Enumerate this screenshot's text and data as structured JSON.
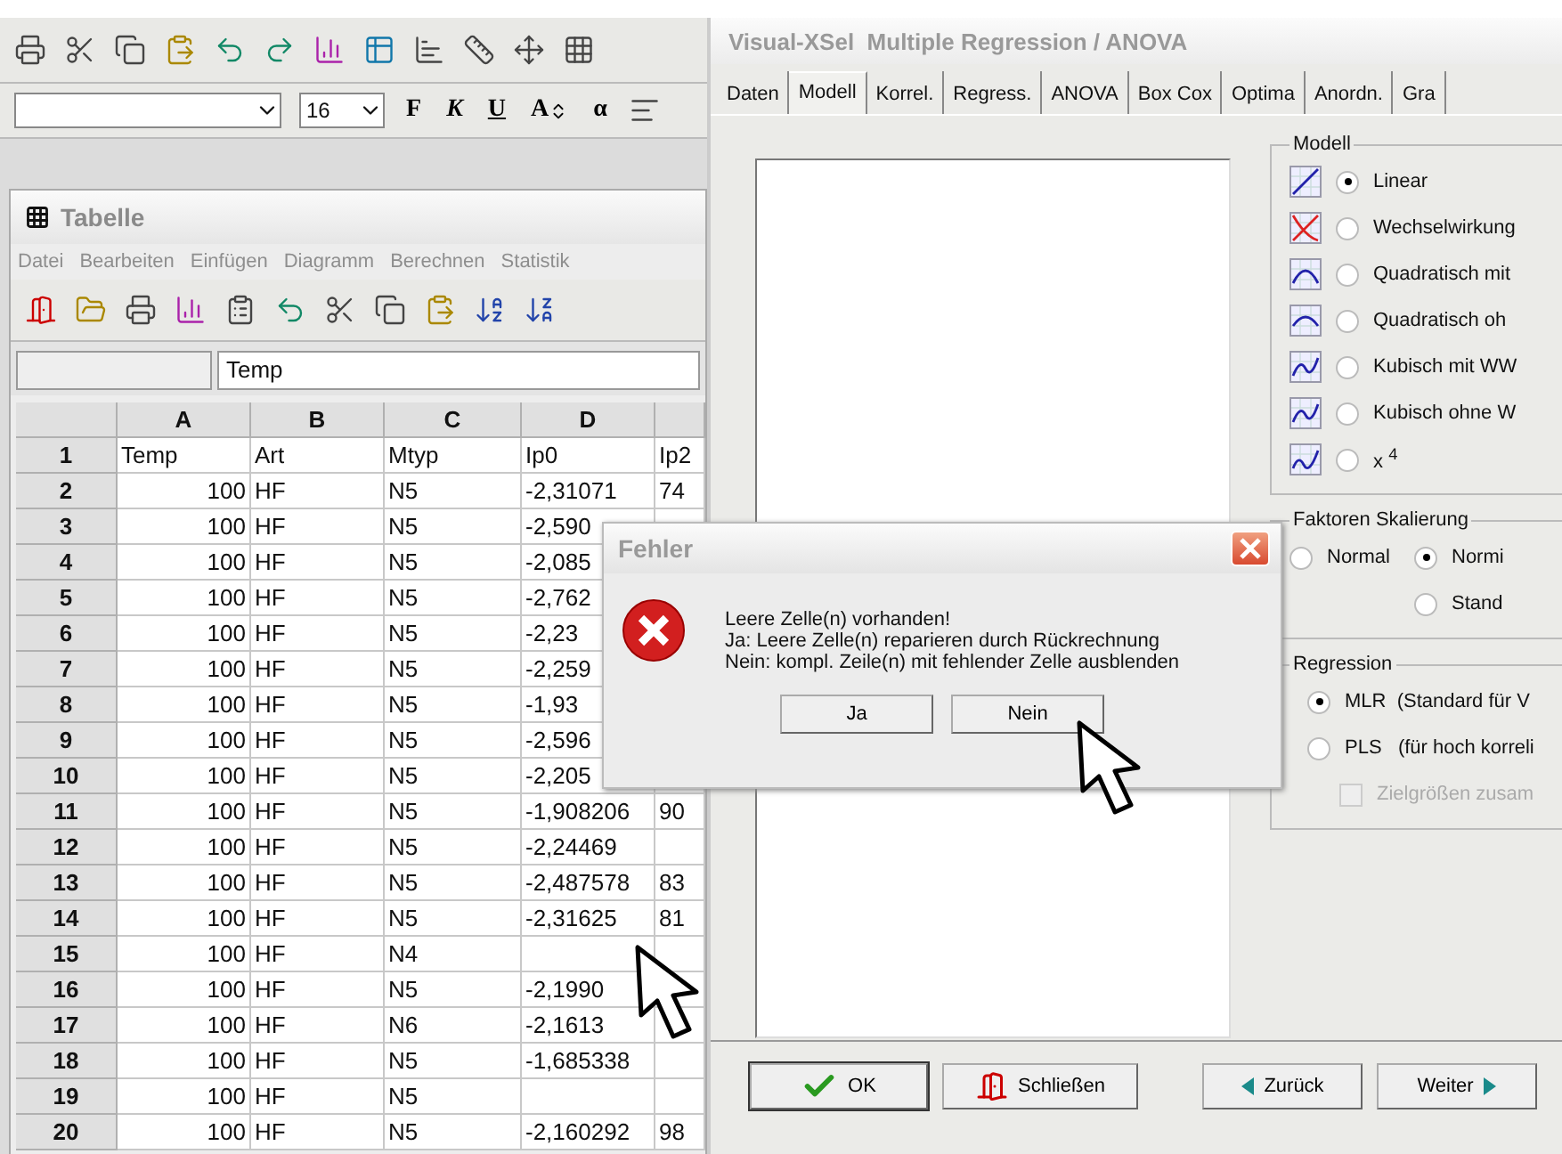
{
  "main_toolbar": {
    "font_size": {
      "value": "16"
    },
    "format_buttons": [
      "F",
      "K",
      "U",
      "A",
      "α"
    ]
  },
  "table_window": {
    "title": "Tabelle",
    "menu": [
      "Datei",
      "Bearbeiten",
      "Einfügen",
      "Diagramm",
      "Berechnen",
      "Statistik"
    ],
    "formula": "Temp",
    "columns": [
      "A",
      "B",
      "C",
      "D"
    ],
    "rows": [
      {
        "n": "1",
        "A": "Temp",
        "B": "Art",
        "C": "Mtyp",
        "D": "Ip0",
        "E": "Ip2"
      },
      {
        "n": "2",
        "A": "100",
        "B": "HF",
        "C": "N5",
        "D": "-2,31071",
        "E": "74"
      },
      {
        "n": "3",
        "A": "100",
        "B": "HF",
        "C": "N5",
        "D": "-2,590"
      },
      {
        "n": "4",
        "A": "100",
        "B": "HF",
        "C": "N5",
        "D": "-2,085"
      },
      {
        "n": "5",
        "A": "100",
        "B": "HF",
        "C": "N5",
        "D": "-2,762"
      },
      {
        "n": "6",
        "A": "100",
        "B": "HF",
        "C": "N5",
        "D": "-2,23"
      },
      {
        "n": "7",
        "A": "100",
        "B": "HF",
        "C": "N5",
        "D": "-2,259"
      },
      {
        "n": "8",
        "A": "100",
        "B": "HF",
        "C": "N5",
        "D": "-1,93"
      },
      {
        "n": "9",
        "A": "100",
        "B": "HF",
        "C": "N5",
        "D": "-2,596"
      },
      {
        "n": "10",
        "A": "100",
        "B": "HF",
        "C": "N5",
        "D": "-2,205"
      },
      {
        "n": "11",
        "A": "100",
        "B": "HF",
        "C": "N5",
        "D": "-1,908206",
        "E": "90"
      },
      {
        "n": "12",
        "A": "100",
        "B": "HF",
        "C": "N5",
        "D": "-2,24469"
      },
      {
        "n": "13",
        "A": "100",
        "B": "HF",
        "C": "N5",
        "D": "-2,487578",
        "E": "83"
      },
      {
        "n": "14",
        "A": "100",
        "B": "HF",
        "C": "N5",
        "D": "-2,31625",
        "E": "81"
      },
      {
        "n": "15",
        "A": "100",
        "B": "HF",
        "C": "N4"
      },
      {
        "n": "16",
        "A": "100",
        "B": "HF",
        "C": "N5",
        "D": "-2,1990"
      },
      {
        "n": "17",
        "A": "100",
        "B": "HF",
        "C": "N6",
        "D": "-2,1613"
      },
      {
        "n": "18",
        "A": "100",
        "B": "HF",
        "C": "N5",
        "D": "-1,685338"
      },
      {
        "n": "19",
        "A": "100",
        "B": "HF",
        "C": "N5"
      },
      {
        "n": "20",
        "A": "100",
        "B": "HF",
        "C": "N5",
        "D": "-2,160292",
        "E": "98"
      }
    ]
  },
  "regression_dialog": {
    "title": "Visual-XSel  Multiple Regression / ANOVA",
    "tabs": [
      {
        "label": "Daten",
        "selected": false
      },
      {
        "label": "Modell",
        "selected": true
      },
      {
        "label": "Korrel.",
        "selected": false
      },
      {
        "label": "Regress.",
        "selected": false
      },
      {
        "label": "ANOVA",
        "selected": false
      },
      {
        "label": "Box Cox",
        "selected": false
      },
      {
        "label": "Optima",
        "selected": false
      },
      {
        "label": "Anordn.",
        "selected": false
      },
      {
        "label": "Gra",
        "selected": false
      }
    ],
    "model_group": {
      "title": "Modell",
      "options": [
        {
          "label": "Linear",
          "selected": true
        },
        {
          "label": "Wechselwirkung",
          "selected": false
        },
        {
          "label": "Quadratisch mit ",
          "selected": false
        },
        {
          "label": "Quadratisch oh",
          "selected": false
        },
        {
          "label": "Kubisch mit WW",
          "selected": false
        },
        {
          "label": "Kubisch ohne W",
          "selected": false
        },
        {
          "label": "x $^{4}$",
          "selected": false
        }
      ]
    },
    "scaling_group": {
      "title": "Faktoren Skalierung",
      "options": [
        {
          "label": "Normal",
          "selected": false
        },
        {
          "label": "Normi",
          "selected": true
        },
        {
          "label": "Stand",
          "selected": false
        }
      ]
    },
    "regression_group": {
      "title": "Regression",
      "options": [
        {
          "label": "MLR  (Standard für V",
          "selected": true
        },
        {
          "label": "PLS   (für hoch korreli",
          "selected": false
        }
      ],
      "checkbox": {
        "label": "Zielgrößen zusam",
        "checked": false,
        "disabled": true
      }
    },
    "buttons": [
      {
        "label": "OK",
        "kind": "ok"
      },
      {
        "label": "Schließen",
        "kind": "close"
      },
      {
        "label": "Zurück",
        "kind": "back"
      },
      {
        "label": "Weiter",
        "kind": "next"
      }
    ]
  },
  "error_dialog": {
    "title": "Fehler",
    "message_lines": [
      "Leere Zelle(n) vorhanden!",
      "Ja: Leere Zelle(n) reparieren durch Rückrechnung",
      "Nein: kompl. Zeile(n) mit fehlender Zelle ausblenden"
    ],
    "buttons": [
      "Ja",
      "Nein"
    ]
  }
}
